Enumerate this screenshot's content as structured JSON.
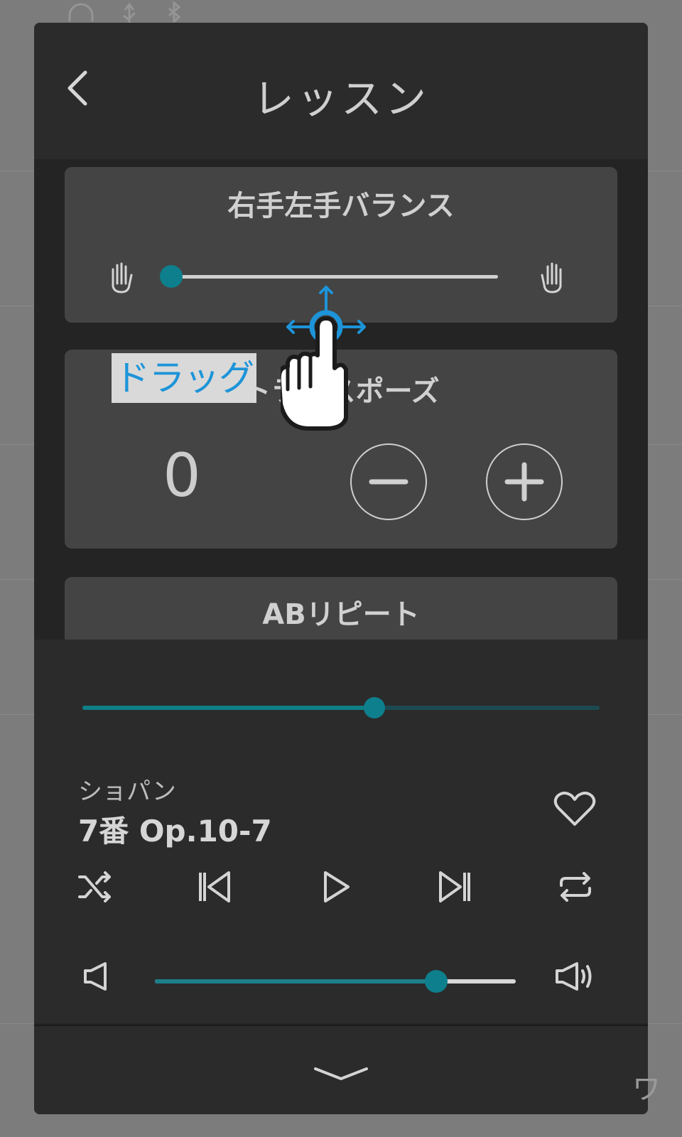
{
  "background": {
    "icons": [
      "headphones-icon",
      "usb-icon",
      "bluetooth-icon"
    ]
  },
  "dialog": {
    "title": "レッスン",
    "back_icon": "chevron-left-icon"
  },
  "balance_card": {
    "title": "右手左手バランス",
    "left_icon": "left-hand-icon",
    "right_icon": "right-hand-icon",
    "value_fraction": 0.0
  },
  "transpose_card": {
    "title": "トランスポーズ",
    "value": "0",
    "minus_icon": "minus-icon",
    "plus_icon": "plus-icon"
  },
  "ab_card": {
    "title": "ABリピート"
  },
  "player": {
    "progress_fraction": 0.565,
    "composer": "ショパン",
    "song": "7番 Op.10-7",
    "controls": [
      "shuffle-icon",
      "previous-icon",
      "play-icon",
      "next-icon",
      "repeat-icon"
    ],
    "volume_fraction": 0.78
  },
  "footer": {
    "collapse_icon": "chevron-down-icon"
  },
  "overlay": {
    "label": "ドラッグ",
    "gesture_icon": "drag-hand-icon"
  },
  "colors": {
    "accent": "#0e7f8c",
    "overlay_blue": "#1d94d8",
    "panel": "#444444",
    "dialog_bg": "#242424"
  }
}
